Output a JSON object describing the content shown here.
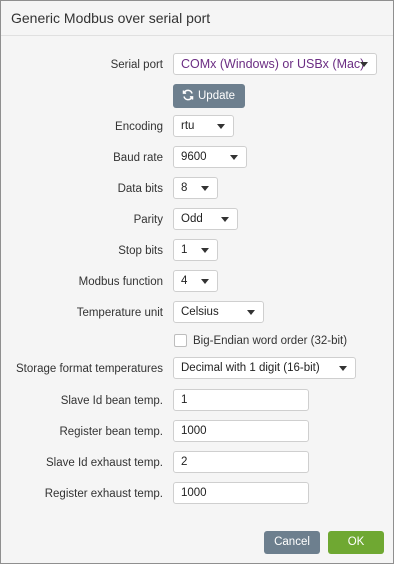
{
  "window": {
    "title": "Generic Modbus over serial port"
  },
  "form": {
    "serial_port": {
      "label": "Serial port",
      "value": "COMx (Windows) or USBx (Mac)"
    },
    "update_button": {
      "label": "Update"
    },
    "encoding": {
      "label": "Encoding",
      "value": "rtu"
    },
    "baud_rate": {
      "label": "Baud rate",
      "value": "9600"
    },
    "data_bits": {
      "label": "Data bits",
      "value": "8"
    },
    "parity": {
      "label": "Parity",
      "value": "Odd"
    },
    "stop_bits": {
      "label": "Stop bits",
      "value": "1"
    },
    "modbus_function": {
      "label": "Modbus function",
      "value": "4"
    },
    "temperature_unit": {
      "label": "Temperature unit",
      "value": "Celsius"
    },
    "big_endian": {
      "label": "Big-Endian word order (32-bit)",
      "checked": false
    },
    "storage_format": {
      "label": "Storage format temperatures",
      "value": "Decimal with 1 digit (16-bit)"
    },
    "slave_id_bean": {
      "label": "Slave Id bean temp.",
      "value": "1"
    },
    "register_bean": {
      "label": "Register bean temp.",
      "value": "1000"
    },
    "slave_id_exhaust": {
      "label": "Slave Id exhaust temp.",
      "value": "2"
    },
    "register_exhaust": {
      "label": "Register exhaust temp.",
      "value": "1000"
    }
  },
  "buttons": {
    "cancel": "Cancel",
    "ok": "OK"
  },
  "colors": {
    "button_gray": "#6d7f8e",
    "button_green": "#6fa832",
    "serial_text": "#6b2d83"
  }
}
